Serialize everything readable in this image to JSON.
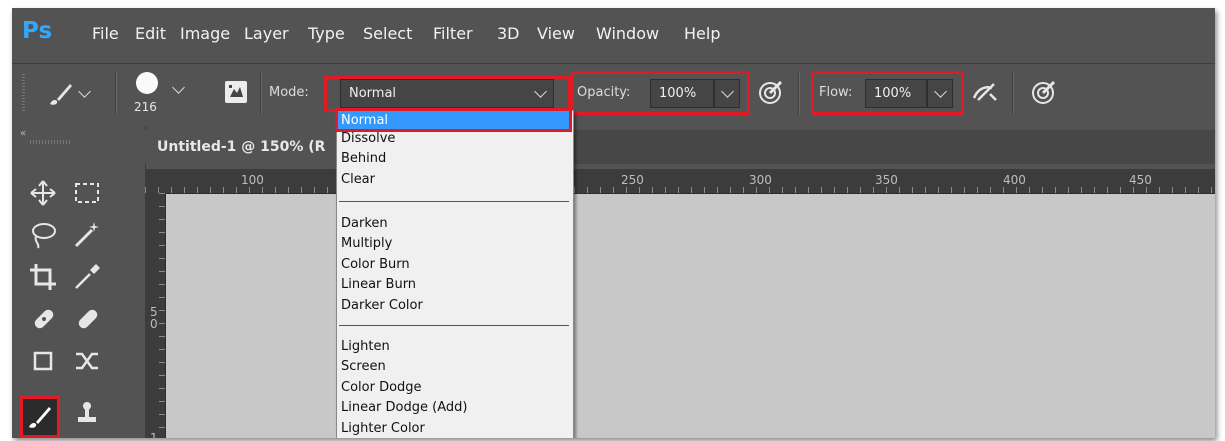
{
  "app": {
    "logo": "Ps",
    "menu": [
      "File",
      "Edit",
      "Image",
      "Layer",
      "Type",
      "Select",
      "Filter",
      "3D",
      "View",
      "Window",
      "Help"
    ]
  },
  "options_bar": {
    "brush_size": "216",
    "mode_label": "Mode:",
    "mode_value": "Normal",
    "opacity_label": "Opacity:",
    "opacity_value": "100%",
    "flow_label": "Flow:",
    "flow_value": "100%"
  },
  "document": {
    "tab_title": "Untitled-1 @ 150% (R"
  },
  "ruler": {
    "top_ticks": [
      "100",
      "250",
      "300",
      "350",
      "400",
      "450"
    ],
    "left_ticks": [
      "5",
      "0",
      "1"
    ]
  },
  "blend_modes": {
    "selected": "Normal",
    "groups": [
      [
        "Normal",
        "Dissolve",
        "Behind",
        "Clear"
      ],
      [
        "Darken",
        "Multiply",
        "Color Burn",
        "Linear Burn",
        "Darker Color"
      ],
      [
        "Lighten",
        "Screen",
        "Color Dodge",
        "Linear Dodge (Add)",
        "Lighter Color"
      ]
    ]
  },
  "tools": [
    "move-tool",
    "marquee-tool",
    "lasso-tool",
    "magic-wand-tool",
    "crop-tool",
    "eyedropper-tool",
    "spot-healing-tool",
    "healing-brush-tool",
    "patch-tool",
    "content-aware-move-tool",
    "brush-tool",
    "clone-stamp-tool"
  ],
  "colors": {
    "accent": "#31a8ff",
    "highlight_box": "#e01b24",
    "selection": "#3399ff",
    "panel": "#535353",
    "canvas": "#c8c8c8"
  }
}
